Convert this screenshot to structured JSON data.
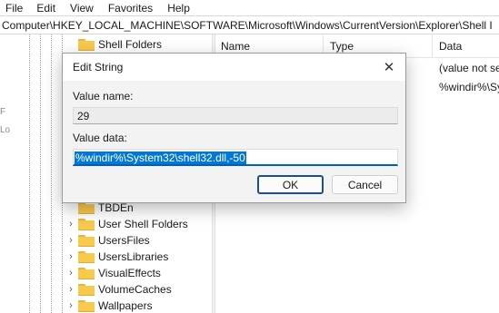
{
  "menu": [
    "File",
    "Edit",
    "View",
    "Favorites",
    "Help"
  ],
  "address_path": "Computer\\HKEY_LOCAL_MACHINE\\SOFTWARE\\Microsoft\\Windows\\CurrentVersion\\Explorer\\Shell I",
  "tree": {
    "top_item": "Shell Folders",
    "items": [
      {
        "label": "TBDEn"
      },
      {
        "label": "User Shell Folders"
      },
      {
        "label": "UsersFiles"
      },
      {
        "label": "UsersLibraries"
      },
      {
        "label": "VisualEffects"
      },
      {
        "label": "VolumeCaches"
      },
      {
        "label": "Wallpapers"
      }
    ],
    "side_fragments": [
      "F",
      "Lo"
    ]
  },
  "list": {
    "headers": {
      "name": "Name",
      "type": "Type",
      "data": "Data"
    },
    "data_values": [
      "(value not se",
      "%windir%\\Sys"
    ]
  },
  "dialog": {
    "title": "Edit String",
    "value_name_label": "Value name:",
    "value_name": "29",
    "value_data_label": "Value data:",
    "value_data": "%windir%\\System32\\shell32.dll,-50",
    "ok_label": "OK",
    "cancel_label": "Cancel",
    "close_glyph": "✕"
  },
  "colors": {
    "selection": "#0078d7",
    "focus_border": "#005fb8",
    "folder": "#f7c94c"
  }
}
